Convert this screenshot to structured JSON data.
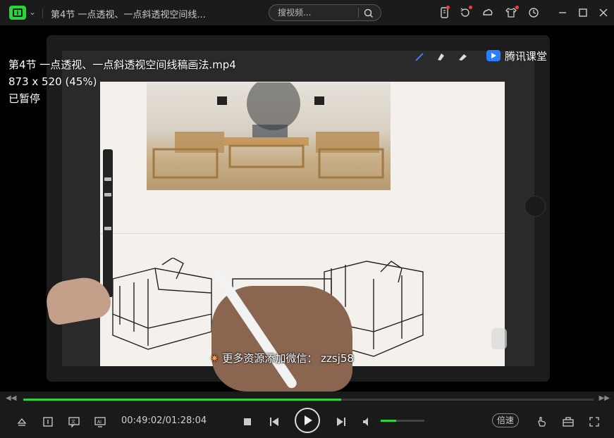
{
  "titlebar": {
    "title": "第4节 一点透视、一点斜透视空间线...",
    "search_placeholder": "搜视频..."
  },
  "overlay": {
    "filename": "第4节 一点透视、一点斜透视空间线稿画法.mp4",
    "resolution": "873 x 520 (45%)",
    "status": "已暂停",
    "watermark": "更多资源添加微信： zzsj58",
    "brand": "腾讯课堂"
  },
  "playback": {
    "current_time": "00:49:02",
    "total_time": "01:28:04",
    "time_display": "00:49:02/01:28:04",
    "progress": 0.558,
    "volume": 0.35,
    "speed_label": "倍速"
  },
  "colors": {
    "accent": "#2fd23e",
    "background": "#1a1a1a",
    "notification": "#ff3b3b"
  }
}
